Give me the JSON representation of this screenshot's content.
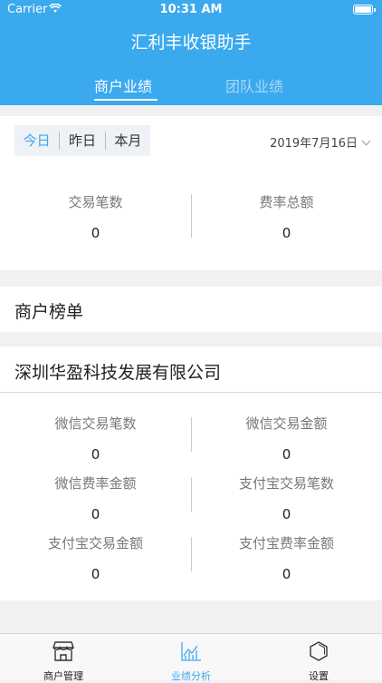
{
  "status_bar": {
    "carrier": "Carrier",
    "time": "10:31 AM"
  },
  "app": {
    "title": "汇利丰收银助手"
  },
  "top_tabs": [
    {
      "label": "商户业绩",
      "active": true
    },
    {
      "label": "团队业绩",
      "active": false
    }
  ],
  "filter": {
    "segments": [
      "今日",
      "昨日",
      "本月"
    ],
    "selected_segment": "今日",
    "date": "2019年7月16日"
  },
  "summary": [
    {
      "label": "交易笔数",
      "value": "0"
    },
    {
      "label": "费率总额",
      "value": "0"
    }
  ],
  "merchant_ranking": {
    "title": "商户榜单"
  },
  "merchant": {
    "name": "深圳华盈科技发展有限公司",
    "stats": [
      {
        "label": "微信交易笔数",
        "value": "0"
      },
      {
        "label": "微信交易金额",
        "value": "0"
      },
      {
        "label": "微信费率金额",
        "value": "0"
      },
      {
        "label": "支付宝交易笔数",
        "value": "0"
      },
      {
        "label": "支付宝交易金额",
        "value": "0"
      },
      {
        "label": "支付宝费率金额",
        "value": "0"
      }
    ]
  },
  "bottom_nav": [
    {
      "label": "商户管理",
      "icon": "store-icon",
      "active": false
    },
    {
      "label": "业绩分析",
      "icon": "chart-icon",
      "active": true
    },
    {
      "label": "设置",
      "icon": "hexagon-icon",
      "active": false
    }
  ],
  "colors": {
    "primary": "#3aa9ee",
    "background": "#f1f1f3"
  }
}
